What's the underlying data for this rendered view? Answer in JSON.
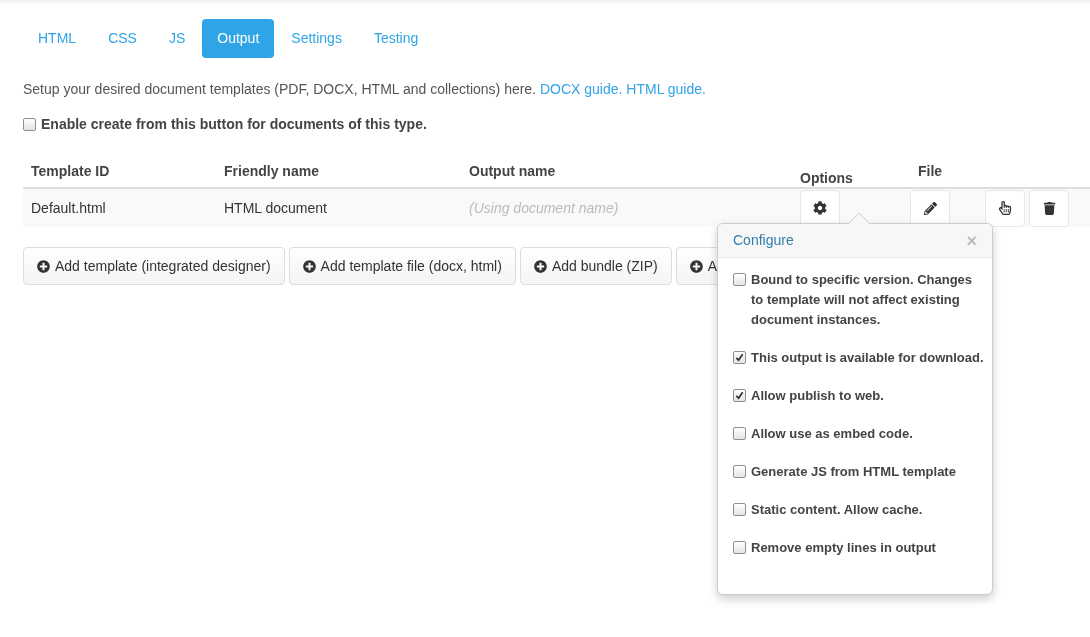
{
  "tabs": [
    {
      "label": "HTML",
      "selected": false
    },
    {
      "label": "CSS",
      "selected": false
    },
    {
      "label": "JS",
      "selected": false
    },
    {
      "label": "Output",
      "selected": true
    },
    {
      "label": "Settings",
      "selected": false
    },
    {
      "label": "Testing",
      "selected": false
    }
  ],
  "intro": {
    "text": "Setup your desired document templates (PDF, DOCX, HTML and collections) here.",
    "links": [
      "DOCX guide.",
      "HTML guide."
    ]
  },
  "enable_option": {
    "label": "Enable create from this button for documents of this type.",
    "checked": false
  },
  "table": {
    "columns": [
      "Template ID",
      "Friendly name",
      "Output name",
      "Options",
      "File"
    ],
    "rows": [
      {
        "template_id": "Default.html",
        "friendly_name": "HTML document",
        "output_name_placeholder": "(Using document name)"
      }
    ]
  },
  "add_buttons": [
    "Add template (integrated designer)",
    "Add template file (docx, html)",
    "Add bundle (ZIP)",
    "A"
  ],
  "popover": {
    "title": "Configure",
    "close": "×",
    "options": [
      {
        "label": "Bound to specific version. Changes to template will not affect existing document instances.",
        "checked": false
      },
      {
        "label": "This output is available for download.",
        "checked": true
      },
      {
        "label": "Allow publish to web.",
        "checked": true
      },
      {
        "label": "Allow use as embed code.",
        "checked": false
      },
      {
        "label": "Generate JS from HTML template",
        "checked": false
      },
      {
        "label": "Static content. Allow cache.",
        "checked": false
      },
      {
        "label": "Remove empty lines in output",
        "checked": false
      }
    ]
  }
}
